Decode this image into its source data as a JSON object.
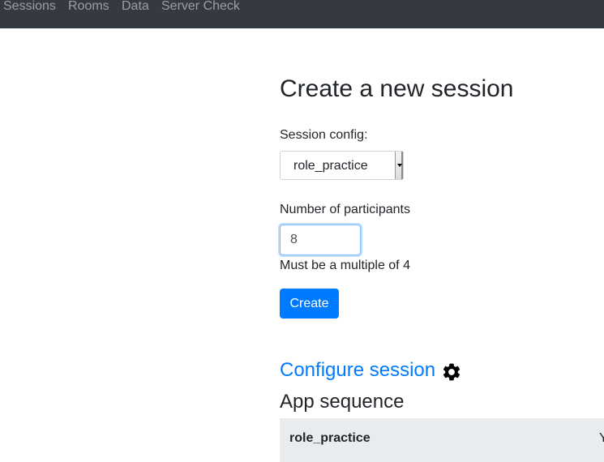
{
  "navbar": {
    "items": [
      {
        "label": "Sessions"
      },
      {
        "label": "Rooms"
      },
      {
        "label": "Data"
      },
      {
        "label": "Server Check"
      }
    ]
  },
  "page": {
    "title": "Create a new session"
  },
  "form": {
    "session_config_label": "Session config:",
    "session_config_value": "role_practice",
    "participants_label": "Number of participants",
    "participants_value": "8",
    "participants_help": "Must be a multiple of 4",
    "create_label": "Create"
  },
  "configure": {
    "link_label": "Configure session",
    "icon": "gear-icon"
  },
  "app_sequence": {
    "title": "App sequence",
    "rows": [
      {
        "app": "role_practice",
        "extra": "Y"
      }
    ]
  },
  "colors": {
    "navbar_bg": "#343a40",
    "accent": "#007bff",
    "table_bg": "#e9ecef"
  }
}
